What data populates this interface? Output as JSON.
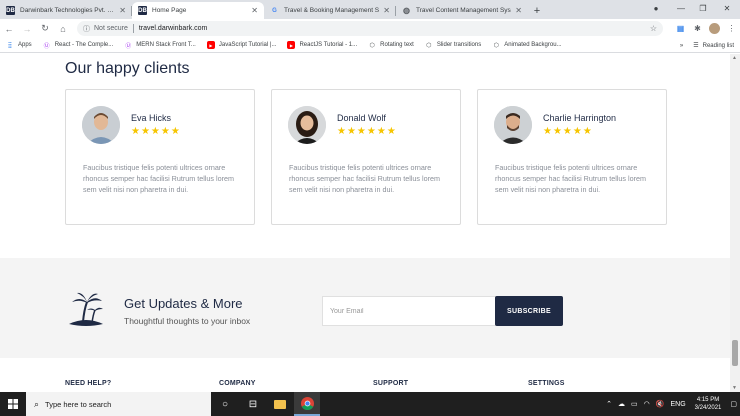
{
  "browser": {
    "tabs": [
      {
        "title": "Darwinbark Technologies Pvt. Ltd.",
        "favicon": "DB",
        "active": false
      },
      {
        "title": "Home Page",
        "favicon": "DB",
        "active": true
      },
      {
        "title": "Travel & Booking Management S",
        "favicon": "G",
        "active": false
      },
      {
        "title": "Travel Content Management Sys",
        "favicon": "globe",
        "active": false
      }
    ],
    "address": {
      "security_label": "Not secure",
      "url": "travel.darwinbark.com"
    },
    "bookmarks": [
      {
        "label": "Apps",
        "icon": "apps-grid-icon"
      },
      {
        "label": "React - The Comple...",
        "icon": "udemy-icon"
      },
      {
        "label": "MERN Stack Front T...",
        "icon": "udemy-icon"
      },
      {
        "label": "JavaScript Tutorial |...",
        "icon": "youtube-icon"
      },
      {
        "label": "ReactJS Tutorial - 1...",
        "icon": "youtube-icon"
      },
      {
        "label": "Rotating text",
        "icon": "codepen-icon"
      },
      {
        "label": "Slider transitions",
        "icon": "codepen-icon"
      },
      {
        "label": "Animated Backgrou...",
        "icon": "codepen-icon"
      }
    ],
    "more_bookmarks": "»",
    "reading_list": "Reading list"
  },
  "page": {
    "section_title": "Our happy clients",
    "clients": [
      {
        "name": "Eva Hicks",
        "rating": 5,
        "stars": "★★★★★",
        "text": "Faucibus tristique felis potenti ultrices ornare rhoncus semper hac facilisi Rutrum tellus lorem sem velit nisi non pharetra in dui."
      },
      {
        "name": "Donald Wolf",
        "rating": 6,
        "stars": "★★★★★★",
        "text": "Faucibus tristique felis potenti ultrices ornare rhoncus semper hac facilisi Rutrum tellus lorem sem velit nisi non pharetra in dui."
      },
      {
        "name": "Charlie Harrington",
        "rating": 5,
        "stars": "★★★★★",
        "text": "Faucibus tristique felis potenti ultrices ornare rhoncus semper hac facilisi Rutrum tellus lorem sem velit nisi non pharetra in dui."
      }
    ],
    "newsletter": {
      "title": "Get Updates & More",
      "subtitle": "Thoughtful thoughts to your inbox",
      "email_placeholder": "Your Email",
      "email_value": "",
      "button_label": "SUBSCRIBE"
    },
    "footer_columns": [
      "NEED HELP?",
      "COMPANY",
      "SUPPORT",
      "SETTINGS"
    ]
  },
  "taskbar": {
    "search_placeholder": "Type here to search",
    "language": "ENG",
    "time": "4:15 PM",
    "date": "3/24/2021"
  },
  "colors": {
    "primary": "#1f2a44",
    "star": "#f6c500",
    "muted_text": "#8a8f98",
    "newsletter_bg": "#f4f4f4"
  }
}
